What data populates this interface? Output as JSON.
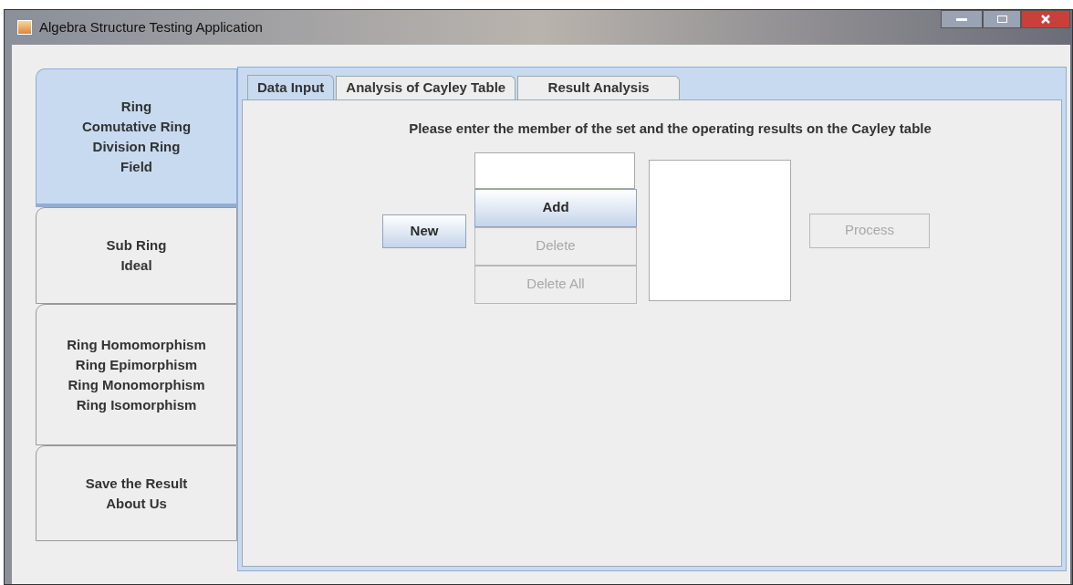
{
  "window": {
    "title": "Algebra Structure Testing Application"
  },
  "side_tabs": [
    {
      "lines": [
        "Ring",
        "Comutative Ring",
        "Division Ring",
        "Field"
      ],
      "selected": true
    },
    {
      "lines": [
        "Sub Ring",
        "Ideal"
      ],
      "selected": false
    },
    {
      "lines": [
        "Ring Homomorphism",
        "Ring Epimorphism",
        "Ring Monomorphism",
        "Ring Isomorphism"
      ],
      "selected": false
    },
    {
      "lines": [
        "Save the Result",
        "About Us"
      ],
      "selected": false
    }
  ],
  "tabs": [
    {
      "label": "Data Input",
      "selected": true
    },
    {
      "label": "Analysis of Cayley Table",
      "selected": false
    },
    {
      "label": "Result Analysis",
      "selected": false
    }
  ],
  "instruction": "Please enter the member of the set and the operating results on the Cayley table",
  "new_button": {
    "label": "New",
    "disabled": false
  },
  "member_buttons": [
    {
      "label": "Add",
      "disabled": false
    },
    {
      "label": "Delete",
      "disabled": true
    },
    {
      "label": "Delete All",
      "disabled": true
    }
  ],
  "process_button": {
    "label": "Process",
    "disabled": true
  }
}
